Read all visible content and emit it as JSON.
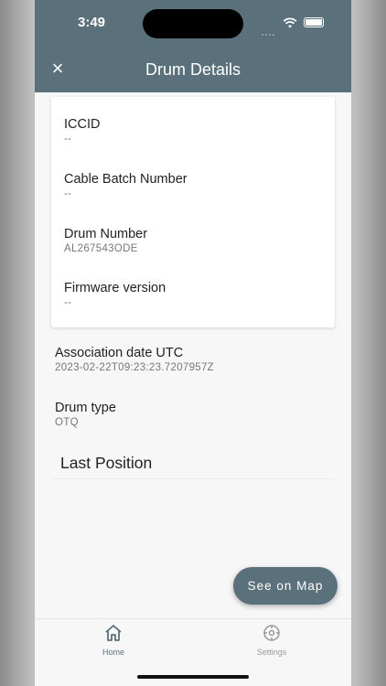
{
  "status_bar": {
    "time": "3:49"
  },
  "header": {
    "title": "Drum Details",
    "close_icon": "×"
  },
  "card_fields": [
    {
      "label": "ICCID",
      "value": "--"
    },
    {
      "label": "Cable Batch Number",
      "value": "--"
    },
    {
      "label": "Drum Number",
      "value": "AL267543ODE"
    },
    {
      "label": "Firmware version",
      "value": "--"
    }
  ],
  "details": [
    {
      "label": "Association date UTC",
      "value": "2023-02-22T09:23:23.7207957Z"
    },
    {
      "label": "Drum type",
      "value": "OTQ"
    }
  ],
  "last_position": {
    "title": "Last Position"
  },
  "fab": {
    "label": "See on Map"
  },
  "tabs": [
    {
      "label": "Home",
      "icon": "home-icon"
    },
    {
      "label": "Settings",
      "icon": "settings-icon"
    }
  ],
  "colors": {
    "primary": "#5a717b",
    "background": "#f7f7f7"
  }
}
